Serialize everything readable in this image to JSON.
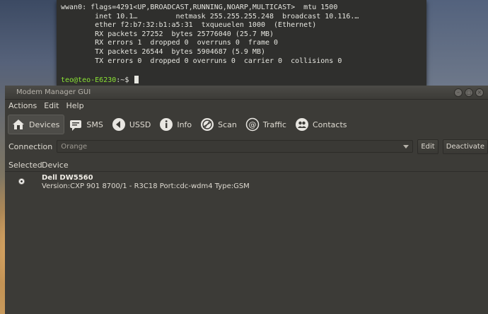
{
  "terminal": {
    "lines": [
      "wwan0: flags=4291<UP,BROADCAST,RUNNING,NOARP,MULTICAST>  mtu 1500",
      "        inet 10.1…         netmask 255.255.255.248  broadcast 10.116.…",
      "        ether f2:b7:32:b1:a5:31  txqueuelen 1000  (Ethernet)",
      "        RX packets 27252  bytes 25776040 (25.7 MB)",
      "        RX errors 1  dropped 0  overruns 0  frame 0",
      "        TX packets 26544  bytes 5904687 (5.9 MB)",
      "        TX errors 0  dropped 0 overruns 0  carrier 0  collisions 0"
    ],
    "prompt_user": "teo@teo-E6230",
    "prompt_path": ":~$"
  },
  "window": {
    "title": "Modem Manager GUI",
    "controls": {
      "minimize": "–",
      "maximize": "□",
      "close": "×"
    }
  },
  "menu": [
    "Actions",
    "Edit",
    "Help"
  ],
  "toolbar": [
    {
      "label": "Devices",
      "icon": "devices-icon",
      "active": true
    },
    {
      "label": "SMS",
      "icon": "sms-icon",
      "active": false
    },
    {
      "label": "USSD",
      "icon": "ussd-icon",
      "active": false
    },
    {
      "label": "Info",
      "icon": "info-icon",
      "active": false
    },
    {
      "label": "Scan",
      "icon": "scan-icon",
      "active": false
    },
    {
      "label": "Traffic",
      "icon": "traffic-icon",
      "active": false
    },
    {
      "label": "Contacts",
      "icon": "contacts-icon",
      "active": false
    }
  ],
  "connection": {
    "label": "Connection",
    "value": "Orange",
    "edit_label": "Edit",
    "deactivate_label": "Deactivate"
  },
  "devices": {
    "columns": {
      "selected": "Selected",
      "device": "Device"
    },
    "rows": [
      {
        "name": "Dell DW5560",
        "info": "Version:CXP 901 8700/1 - R3C18 Port:cdc-wdm4 Type:GSM",
        "selected": true
      }
    ]
  },
  "colors": {
    "terminal_bg": "#2f2f2d",
    "prompt_green": "#8ae234",
    "window_bg": "#3c3b37",
    "text": "#dfdbd2"
  }
}
